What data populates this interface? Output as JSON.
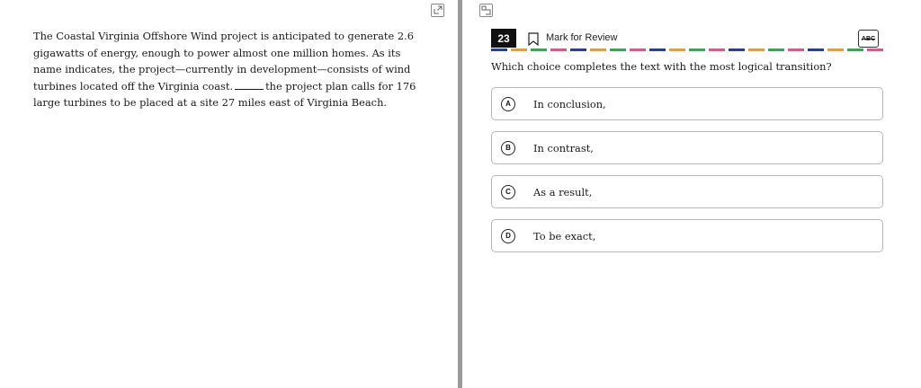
{
  "passage": {
    "line1": "The Coastal Virginia Offshore Wind project is anticipated to generate 2.6",
    "line2": "gigawatts of energy, enough to power almost one million homes. As its",
    "line3": "name indicates, the project—currently in development—consists of wind",
    "line4a": "turbines located off the Virginia coast.",
    "line4b": "the project plan calls for 176",
    "line5": "large turbines to be placed at a site 27 miles east of Virginia Beach."
  },
  "question": {
    "number": "23",
    "mark_for_review_label": "Mark for Review",
    "abc_label": "ABC",
    "prompt": "Which choice completes the text with the most logical transition?"
  },
  "choices": [
    {
      "letter": "A",
      "text": "In conclusion,"
    },
    {
      "letter": "B",
      "text": "In contrast,"
    },
    {
      "letter": "C",
      "text": "As a result,"
    },
    {
      "letter": "D",
      "text": "To be exact,"
    }
  ],
  "icons": {
    "left_expand": "expand-icon",
    "right_expand": "collapse-icon",
    "bookmark": "bookmark-icon"
  }
}
